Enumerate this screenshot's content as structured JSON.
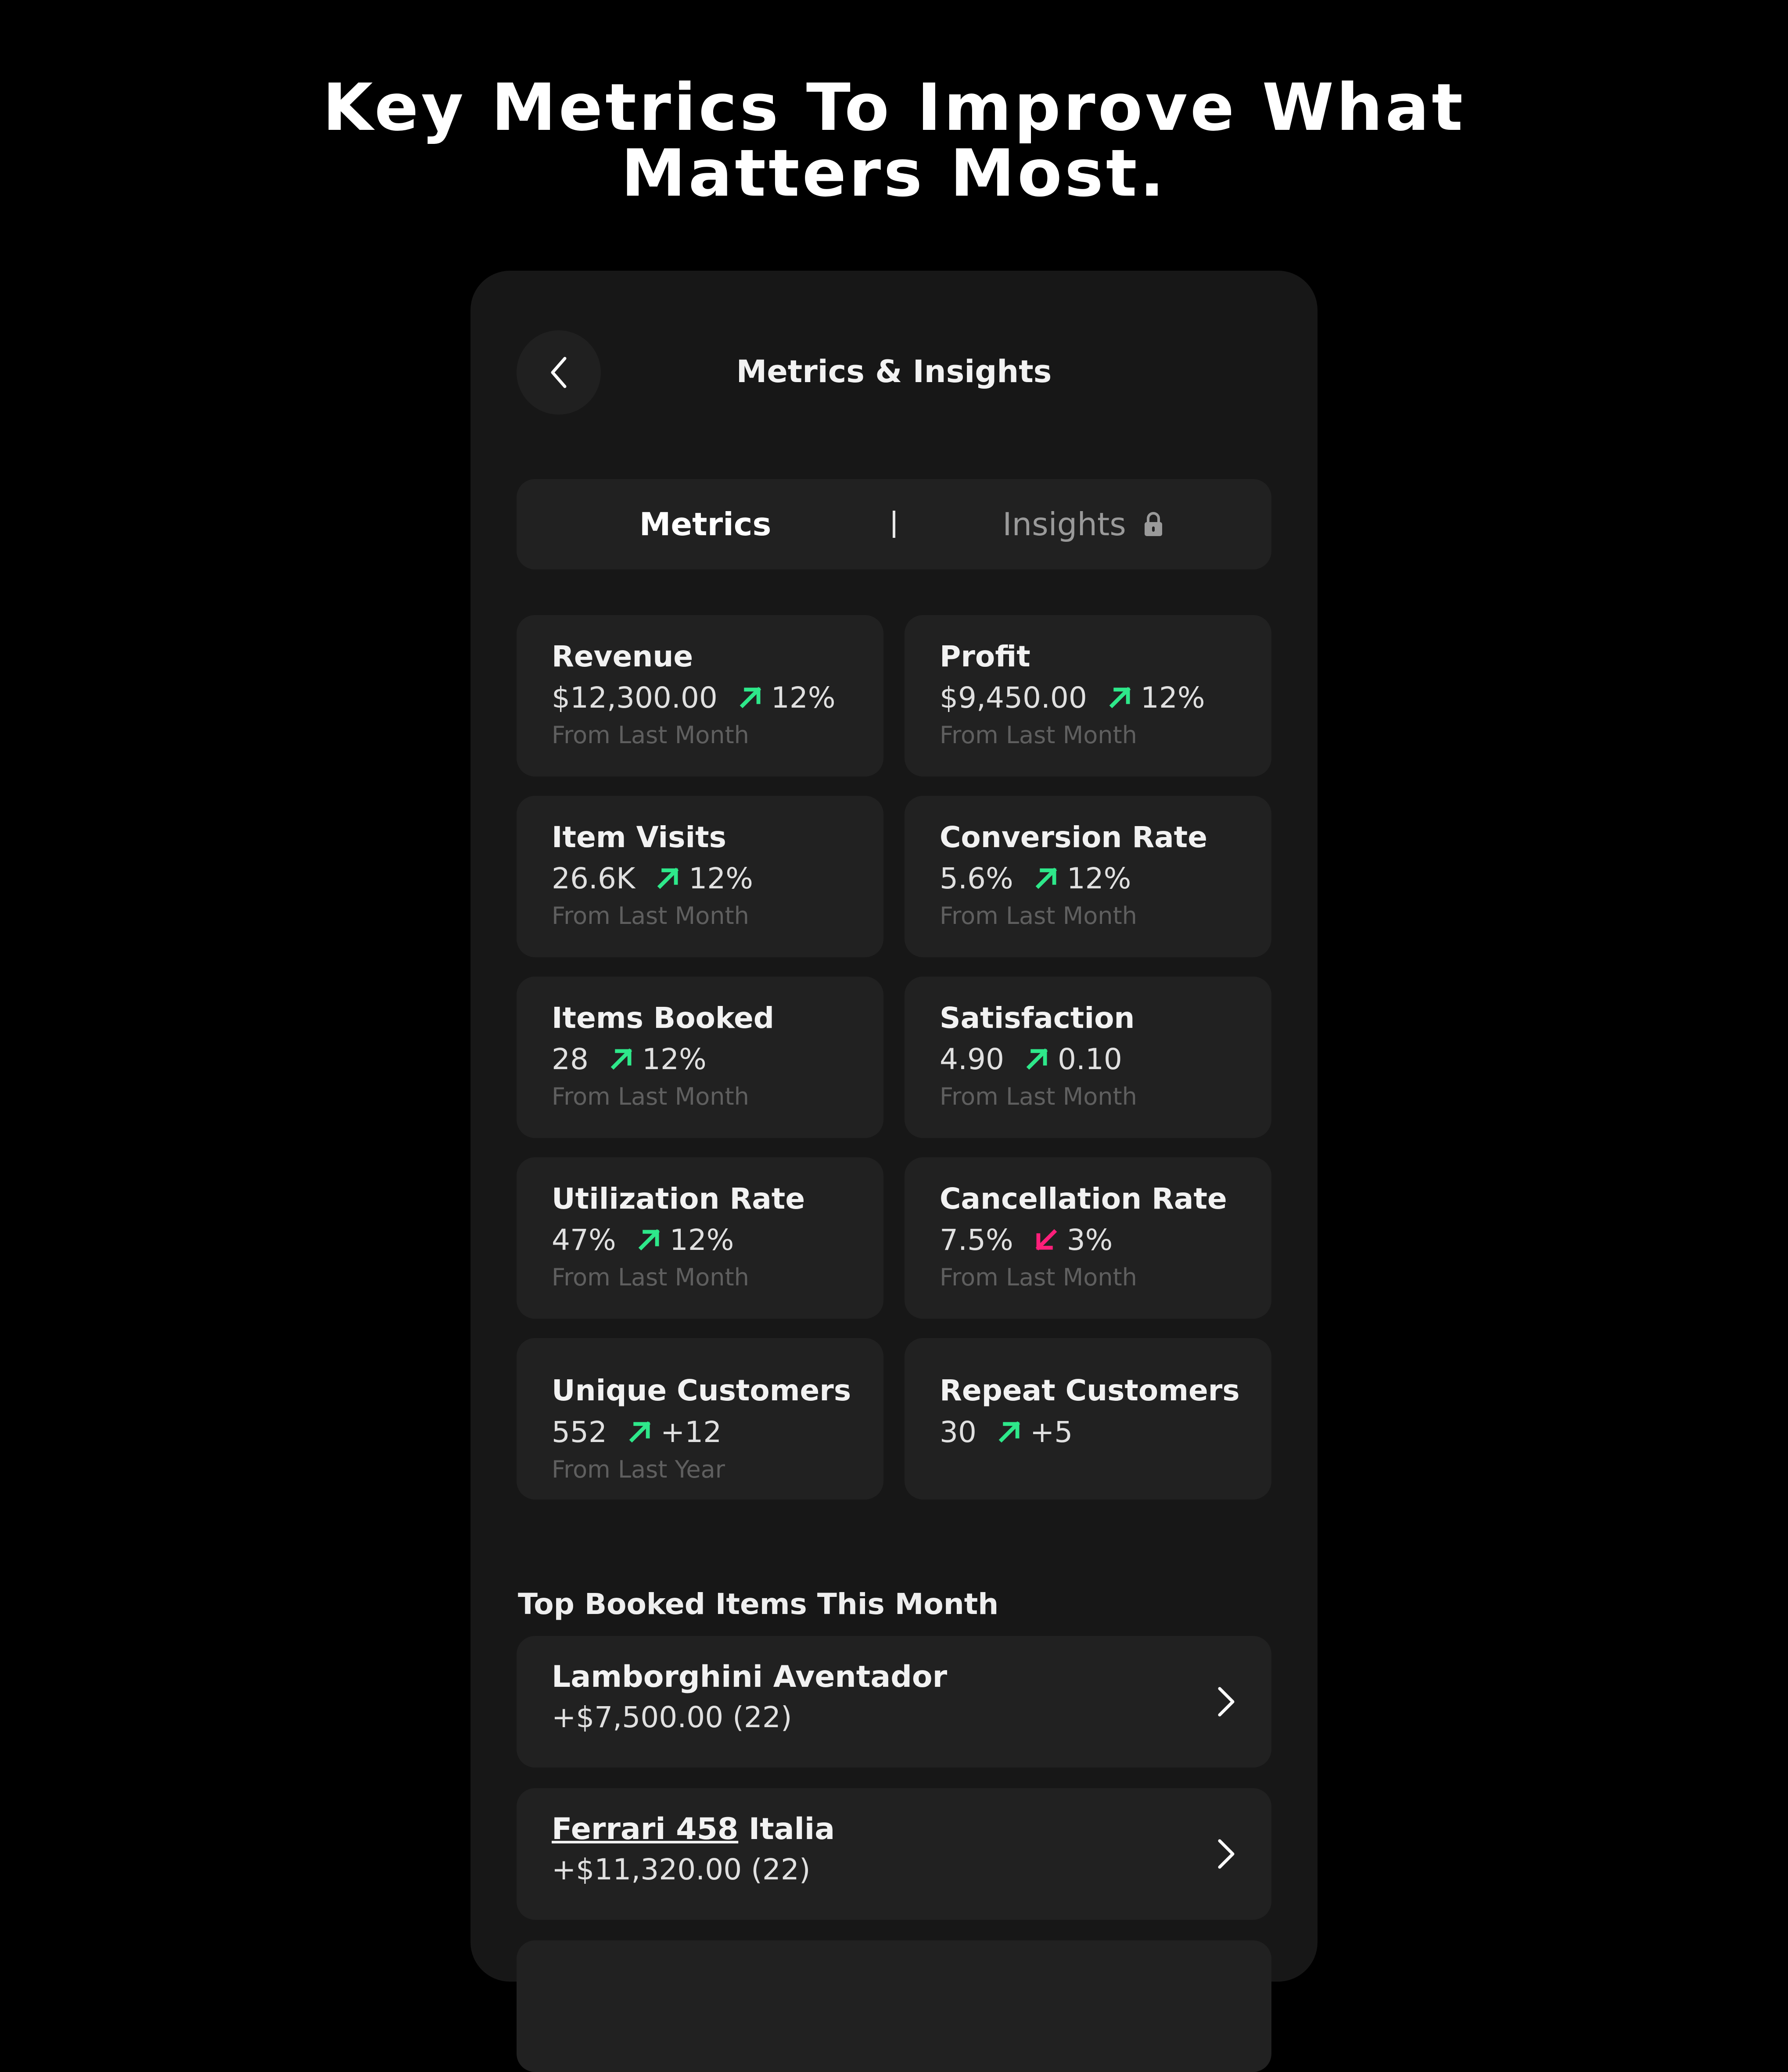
{
  "headline": {
    "line1": "Key Metrics To Improve What",
    "line2": "Matters Most."
  },
  "screen": {
    "title": "Metrics & Insights",
    "back_icon": "chevron-left-icon"
  },
  "tabs": [
    {
      "label": "Metrics",
      "active": true
    },
    {
      "label": "Insights",
      "locked": true,
      "icon": "lock-icon"
    }
  ],
  "colors": {
    "background": "#000000",
    "panel": "#171717",
    "card": "#212121",
    "up": "#2ee88a",
    "down": "#ff1f7a",
    "muted_text": "#5f5f5f"
  },
  "metrics": [
    {
      "title": "Revenue",
      "value": "$12,300.00",
      "trend": "up",
      "change": "12%",
      "period": "From Last Month"
    },
    {
      "title": "Profit",
      "value": "$9,450.00",
      "trend": "up",
      "change": "12%",
      "period": "From Last Month"
    },
    {
      "title": "Item Visits",
      "value": "26.6K",
      "trend": "up",
      "change": "12%",
      "period": "From Last Month"
    },
    {
      "title": "Conversion Rate",
      "value": "5.6%",
      "trend": "up",
      "change": "12%",
      "period": "From Last Month"
    },
    {
      "title": "Items Booked",
      "value": "28",
      "trend": "up",
      "change": "12%",
      "period": "From Last Month"
    },
    {
      "title": "Satisfaction",
      "value": "4.90",
      "trend": "up",
      "change": "0.10",
      "period": "From Last Month"
    },
    {
      "title": "Utilization Rate",
      "value": "47%",
      "trend": "up",
      "change": "12%",
      "period": "From Last Month"
    },
    {
      "title": "Cancellation Rate",
      "value": "7.5%",
      "trend": "down",
      "change": "3%",
      "period": "From Last Month"
    },
    {
      "title": "Unique Customers",
      "value": "552",
      "trend": "up",
      "change": "+12",
      "period": "From Last Year"
    },
    {
      "title": "Repeat Customers",
      "value": "30",
      "trend": "up",
      "change": "+5",
      "period": ""
    }
  ],
  "top_items": {
    "title": "Top Booked Items This Month",
    "items": [
      {
        "name": "Lamborghini Aventador",
        "value": "+$7,500.00 (22)"
      },
      {
        "name_underlined": "Ferrari 458",
        "name_rest": " Italia",
        "value": "+$11,320.00 (22)"
      }
    ]
  }
}
